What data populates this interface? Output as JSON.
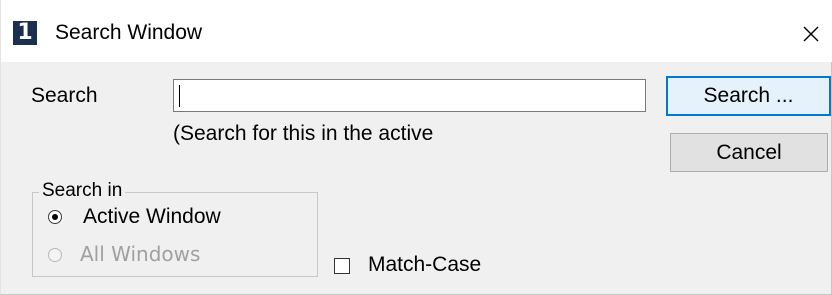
{
  "window": {
    "icon_label": "1",
    "title": "Search Window",
    "close_glyph": "×"
  },
  "search": {
    "label": "Search",
    "value": "",
    "hint": "(Search for this  in the active"
  },
  "buttons": {
    "search": "Search ...",
    "cancel": "Cancel"
  },
  "search_in": {
    "legend": "Search in",
    "options": [
      {
        "label": "Active Window",
        "selected": true,
        "enabled": true
      },
      {
        "label": "All Windows",
        "selected": false,
        "enabled": false
      }
    ]
  },
  "match_case": {
    "label": "Match-Case",
    "checked": false
  },
  "colors": {
    "icon_bg": "#1b2f4f",
    "default_button_border": "#0078d7",
    "disabled_text": "#a0a0a0"
  },
  "icons": [
    "app-icon",
    "close-icon",
    "radio-selected-icon",
    "radio-unselected-icon",
    "checkbox-icon"
  ]
}
